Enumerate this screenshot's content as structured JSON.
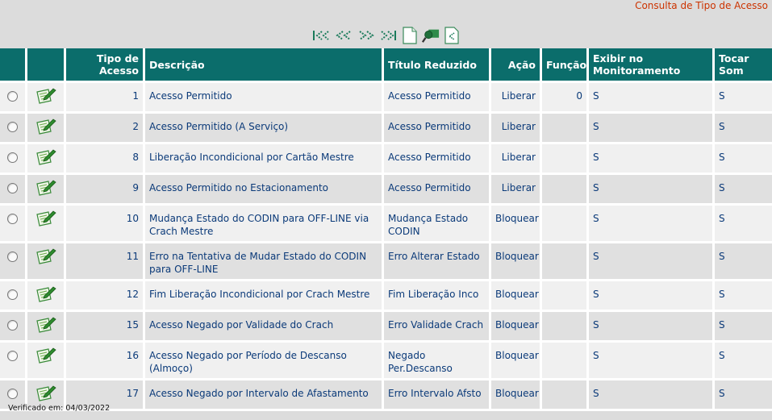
{
  "page_title": "Consulta de Tipo de Acesso",
  "toolbar": {
    "first_label": "|<<",
    "prev_label": "<<",
    "next_label": ">>",
    "last_label": ">>|",
    "icons": [
      "new-document-icon",
      "search-filter-icon",
      "export-document-icon"
    ]
  },
  "columns": {
    "tipo": "Tipo de Acesso",
    "descricao": "Descrição",
    "titulo": "Título Reduzido",
    "acao": "Ação",
    "funcao": "Função",
    "exibir": "Exibir no Monitoramento",
    "tocar": "Tocar Som"
  },
  "rows": [
    {
      "tipo": "1",
      "descricao": "Acesso Permitido",
      "titulo": "Acesso Permitido",
      "acao": "Liberar",
      "funcao": "0",
      "exibir": "S",
      "tocar": "S"
    },
    {
      "tipo": "2",
      "descricao": "Acesso Permitido (A Serviço)",
      "titulo": "Acesso Permitido",
      "acao": "Liberar",
      "funcao": "",
      "exibir": "S",
      "tocar": "S"
    },
    {
      "tipo": "8",
      "descricao": "Liberação Incondicional por Cartão Mestre",
      "titulo": "Acesso Permitido",
      "acao": "Liberar",
      "funcao": "",
      "exibir": "S",
      "tocar": "S"
    },
    {
      "tipo": "9",
      "descricao": "Acesso Permitido no Estacionamento",
      "titulo": "Acesso Permitido",
      "acao": "Liberar",
      "funcao": "",
      "exibir": "S",
      "tocar": "S"
    },
    {
      "tipo": "10",
      "descricao": "Mudança Estado do CODIN para OFF-LINE via Crach  Mestre",
      "titulo": "Mudança Estado CODIN",
      "acao": "Bloquear",
      "funcao": "",
      "exibir": "S",
      "tocar": "S"
    },
    {
      "tipo": "11",
      "descricao": "Erro na Tentativa de Mudar Estado do CODIN para OFF-LINE",
      "titulo": "Erro Alterar Estado",
      "acao": "Bloquear",
      "funcao": "",
      "exibir": "S",
      "tocar": "S"
    },
    {
      "tipo": "12",
      "descricao": "Fim Liberação Incondicional por Crach  Mestre",
      "titulo": "Fim Liberação Inco",
      "acao": "Bloquear",
      "funcao": "",
      "exibir": "S",
      "tocar": "S"
    },
    {
      "tipo": "15",
      "descricao": "Acesso Negado por Validade do Crach",
      "titulo": "Erro Validade Crach",
      "acao": "Bloquear",
      "funcao": "",
      "exibir": "S",
      "tocar": "S"
    },
    {
      "tipo": "16",
      "descricao": "Acesso Negado por Período de Descanso (Almoço)",
      "titulo": "Negado Per.Descanso",
      "acao": "Bloquear",
      "funcao": "",
      "exibir": "S",
      "tocar": "S"
    },
    {
      "tipo": "17",
      "descricao": "Acesso Negado por Intervalo de Afastamento",
      "titulo": "Erro Intervalo Afsto",
      "acao": "Bloquear",
      "funcao": "",
      "exibir": "S",
      "tocar": "S"
    }
  ],
  "footer": "Verificado em: 04/03/2022",
  "colors": {
    "header_bg": "#0b6d6b",
    "title": "#cc3300",
    "text": "#0b3a79"
  }
}
